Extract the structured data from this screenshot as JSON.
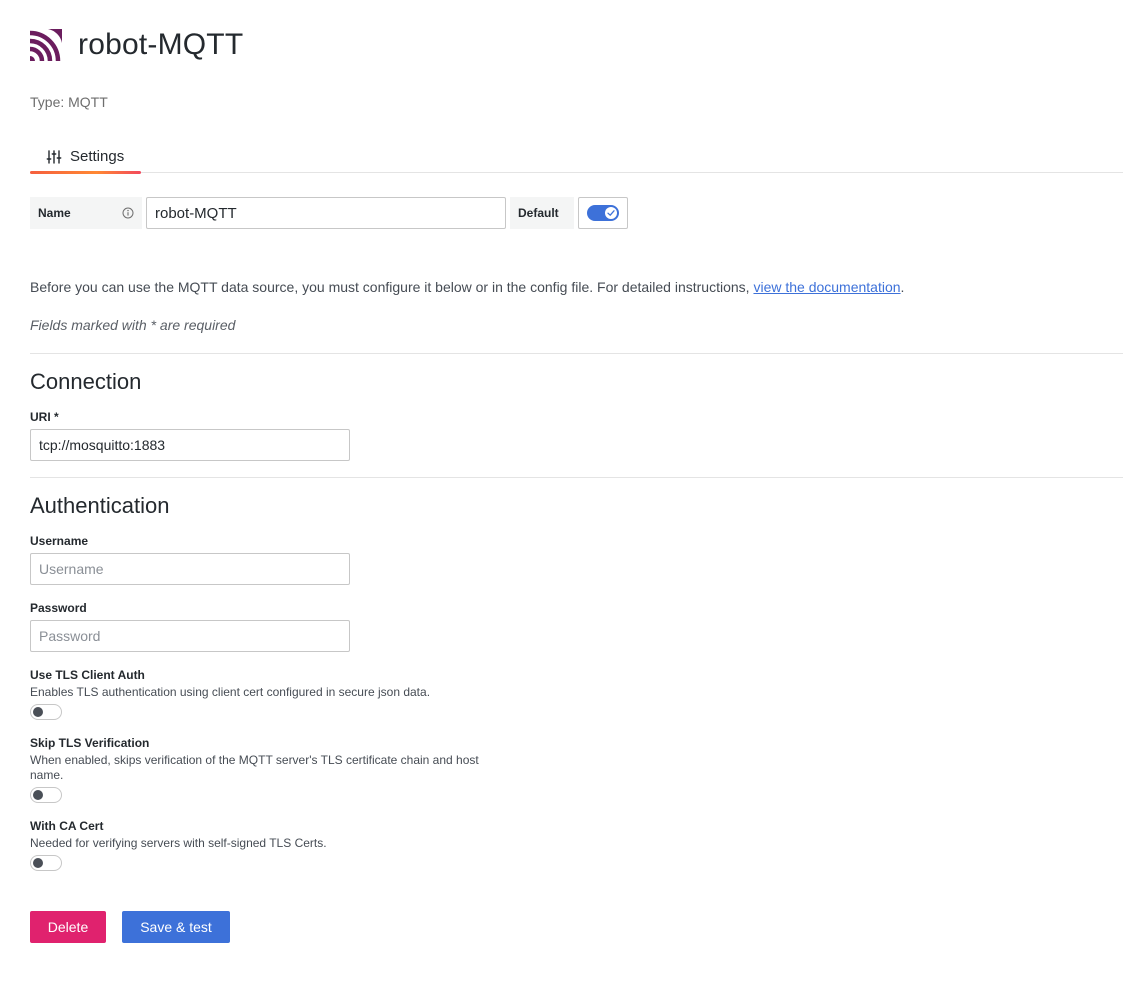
{
  "header": {
    "title": "robot-MQTT",
    "logo_icon": "mqtt-logo-icon",
    "type_text": "Type: MQTT"
  },
  "tabs": [
    {
      "label": "Settings",
      "icon": "sliders-icon",
      "active": true
    }
  ],
  "name_row": {
    "name_label": "Name",
    "name_value": "robot-MQTT",
    "default_label": "Default",
    "default_enabled": true
  },
  "intro": {
    "text": "Before you can use the MQTT data source, you must configure it below or in the config file. For detailed instructions, ",
    "link_text": "view the documentation",
    "suffix": ".",
    "required_note": "Fields marked with * are required"
  },
  "connection": {
    "title": "Connection",
    "uri_label": "URI *",
    "uri_value": "tcp://mosquitto:1883"
  },
  "authentication": {
    "title": "Authentication",
    "username_label": "Username",
    "username_placeholder": "Username",
    "password_label": "Password",
    "password_placeholder": "Password",
    "tls_client_auth": {
      "label": "Use TLS Client Auth",
      "description": "Enables TLS authentication using client cert configured in secure json data.",
      "enabled": false
    },
    "skip_tls": {
      "label": "Skip TLS Verification",
      "description": "When enabled, skips verification of the MQTT server's TLS certificate chain and host name.",
      "enabled": false
    },
    "ca_cert": {
      "label": "With CA Cert",
      "description": "Needed for verifying servers with self-signed TLS Certs.",
      "enabled": false
    }
  },
  "actions": {
    "delete_label": "Delete",
    "save_label": "Save & test"
  },
  "colors": {
    "primary": "#3d71d9",
    "destructive": "#e0226e",
    "logo": "#6b1d5e"
  }
}
